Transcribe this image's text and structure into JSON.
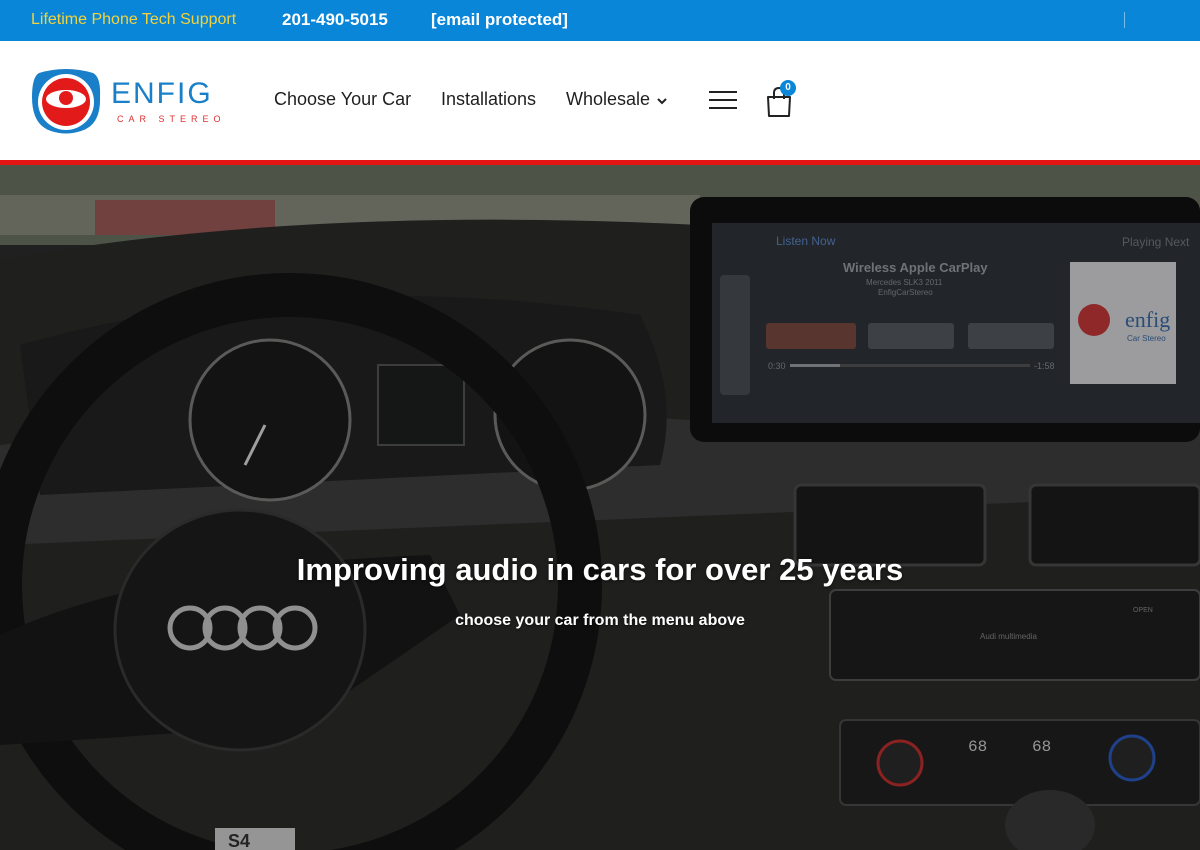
{
  "topbar": {
    "support_text": "Lifetime Phone Tech Support",
    "phone": "201-490-5015",
    "email": "[email protected]"
  },
  "brand": {
    "name": "ENFIG",
    "tagline": "CAR STEREO"
  },
  "nav": {
    "items": [
      {
        "label": "Choose Your Car"
      },
      {
        "label": "Installations"
      },
      {
        "label": "Wholesale"
      }
    ],
    "cart_count": "0"
  },
  "hero": {
    "title": "Improving audio in cars for over 25 years",
    "subtitle": "choose your car from the menu above",
    "screen": {
      "listen_now": "Listen Now",
      "playing_next": "Playing Next",
      "track_title": "Wireless Apple CarPlay",
      "track_line2": "Mercedes SLK3 2011",
      "track_line3": "EnfigCarStereo",
      "time_elapsed": "0:30",
      "time_remaining": "-1:58",
      "album_brand": "enfig",
      "album_sub": "Car Stereo"
    },
    "console": {
      "temp_left": "68",
      "temp_right": "68",
      "unit_label": "Audi multimedia",
      "open_label": "OPEN"
    },
    "badge": "S4"
  },
  "colors": {
    "topbar_bg": "#0a86d8",
    "support_text": "#f4d23b",
    "accent_red": "#e31414",
    "brand_blue": "#1a7fc9"
  }
}
